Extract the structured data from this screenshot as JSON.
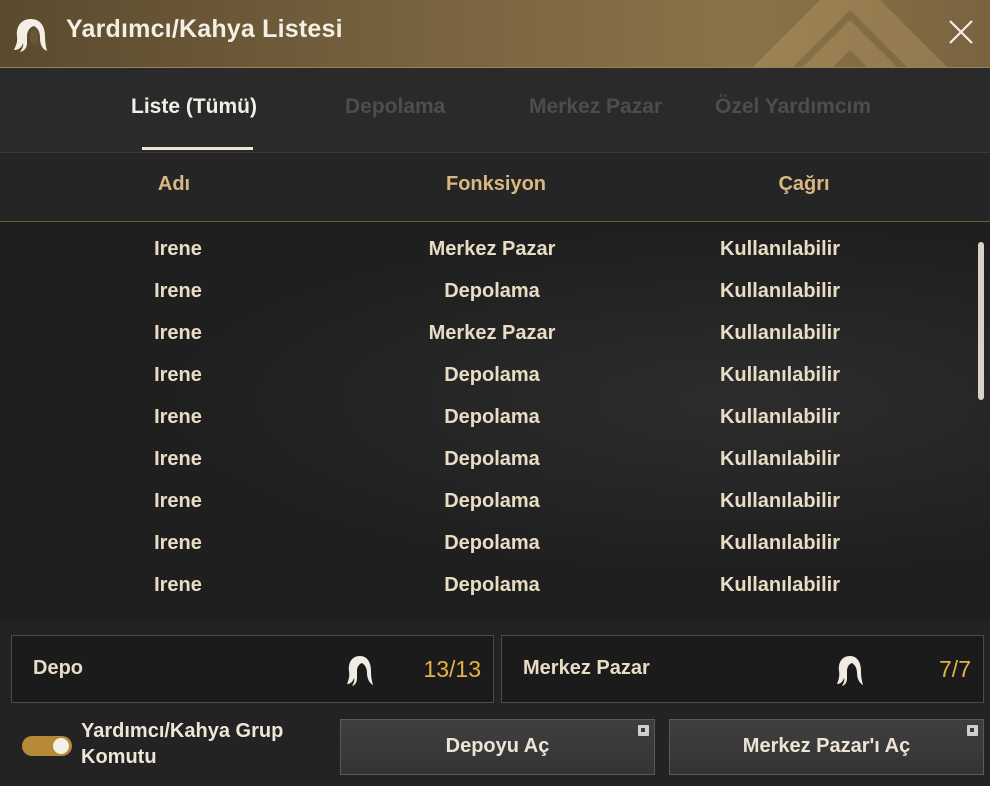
{
  "window": {
    "title": "Yardımcı/Kahya Listesi"
  },
  "tabs": [
    {
      "label": "Liste (Tümü)",
      "active": true
    },
    {
      "label": "Depolama",
      "active": false
    },
    {
      "label": "Merkez Pazar",
      "active": false
    },
    {
      "label": "Özel Yardımcım",
      "active": false
    }
  ],
  "table": {
    "headers": [
      "Adı",
      "Fonksiyon",
      "Çağrı"
    ],
    "rows": [
      [
        "Irene",
        "Merkez Pazar",
        "Kullanılabilir"
      ],
      [
        "Irene",
        "Depolama",
        "Kullanılabilir"
      ],
      [
        "Irene",
        "Merkez Pazar",
        "Kullanılabilir"
      ],
      [
        "Irene",
        "Depolama",
        "Kullanılabilir"
      ],
      [
        "Irene",
        "Depolama",
        "Kullanılabilir"
      ],
      [
        "Irene",
        "Depolama",
        "Kullanılabilir"
      ],
      [
        "Irene",
        "Depolama",
        "Kullanılabilir"
      ],
      [
        "Irene",
        "Depolama",
        "Kullanılabilir"
      ],
      [
        "Irene",
        "Depolama",
        "Kullanılabilir"
      ]
    ]
  },
  "summary": {
    "storage": {
      "label": "Depo",
      "count": "13/13"
    },
    "market": {
      "label": "Merkez Pazar",
      "count": "7/7"
    }
  },
  "group_command": {
    "label": "Yardımcı/Kahya Grup Komutu",
    "enabled": true
  },
  "buttons": {
    "open_storage": "Depoyu Aç",
    "open_market": "Merkez Pazar'ı Aç"
  },
  "colors": {
    "accent": "#e3b24a",
    "header_text": "#d9b880",
    "titlebar": "#7a6440"
  },
  "icons": {
    "title": "maid-icon",
    "close": "close-icon",
    "counter": "maid-icon",
    "external": "external-window-icon"
  }
}
